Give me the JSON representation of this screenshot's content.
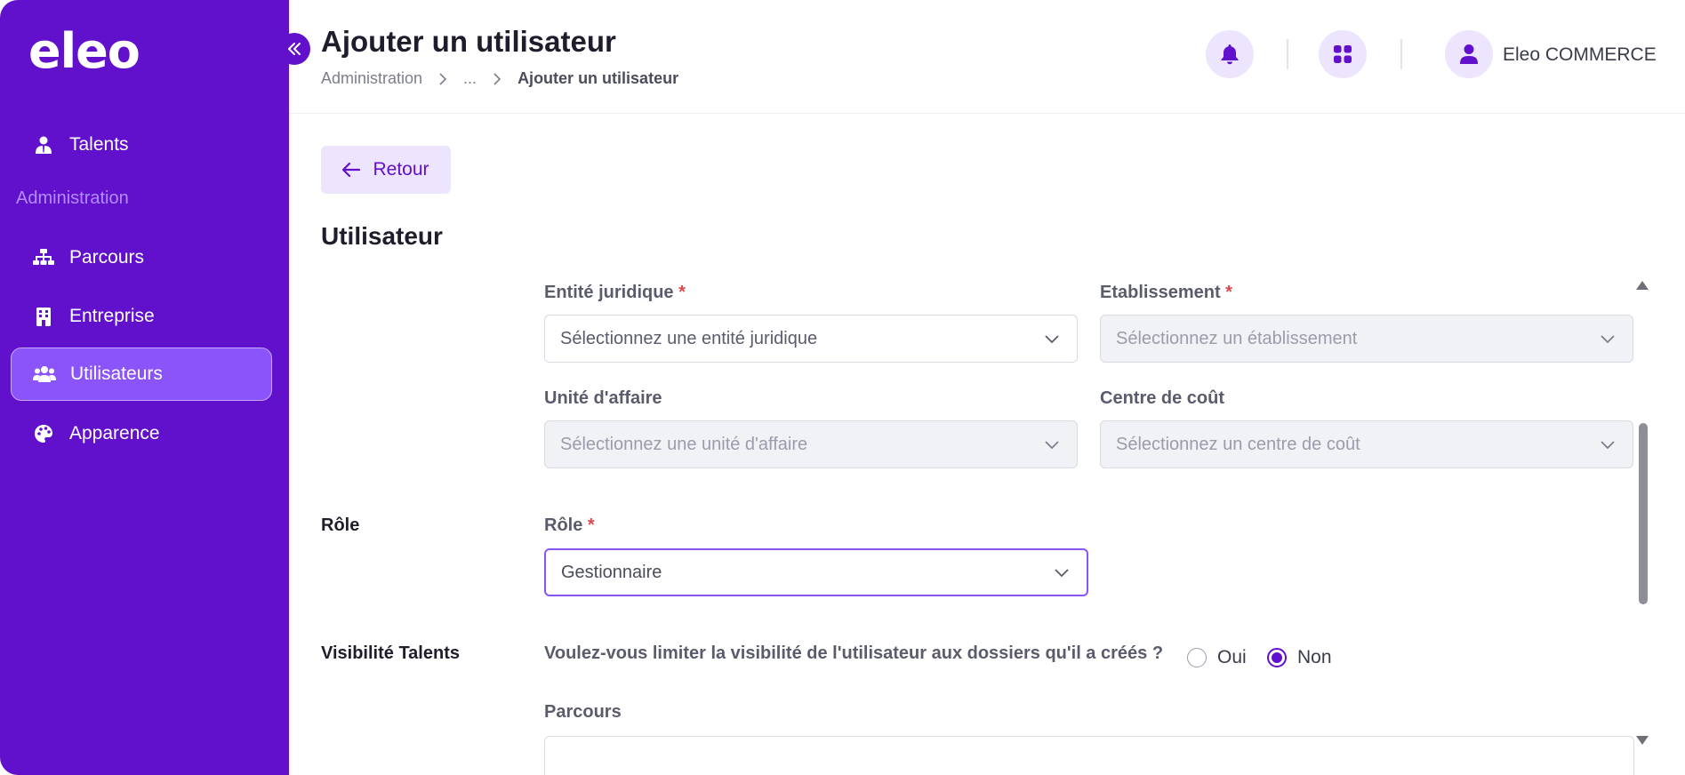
{
  "brand": {
    "logo_text": "eleo",
    "accent": "#6111cc"
  },
  "sidebar": {
    "section_label": "Administration",
    "items": [
      {
        "label": "Talents",
        "icon": "user-tie-icon"
      },
      {
        "label": "Parcours",
        "icon": "sitemap-icon"
      },
      {
        "label": "Entreprise",
        "icon": "building-icon"
      },
      {
        "label": "Utilisateurs",
        "icon": "users-icon",
        "active": true
      },
      {
        "label": "Apparence",
        "icon": "palette-icon"
      }
    ]
  },
  "header": {
    "title": "Ajouter un utilisateur",
    "breadcrumb": [
      "Administration",
      "...",
      "Ajouter un utilisateur"
    ],
    "user_name": "Eleo COMMERCE"
  },
  "content": {
    "back_label": "Retour",
    "section_title": "Utilisateur",
    "fields": {
      "entite": {
        "label": "Entité juridique",
        "required_mark": "*",
        "placeholder": "Sélectionnez une entité juridique"
      },
      "etablissement": {
        "label": "Etablissement",
        "required_mark": "*",
        "placeholder": "Sélectionnez un établissement"
      },
      "unite": {
        "label": "Unité d'affaire",
        "placeholder": "Sélectionnez une unité d'affaire"
      },
      "centre": {
        "label": "Centre de coût",
        "placeholder": "Sélectionnez un centre de coût"
      },
      "role": {
        "label": "Rôle",
        "required_mark": "*",
        "value": "Gestionnaire"
      },
      "parcours": {
        "label": "Parcours"
      }
    },
    "row_labels": {
      "role": "Rôle",
      "visibilite": "Visibilité Talents"
    },
    "visibility": {
      "question": "Voulez-vous limiter la visibilité de l'utilisateur aux dossiers qu'il a créés ?",
      "options": [
        "Oui",
        "Non"
      ],
      "selected": "Non"
    }
  }
}
